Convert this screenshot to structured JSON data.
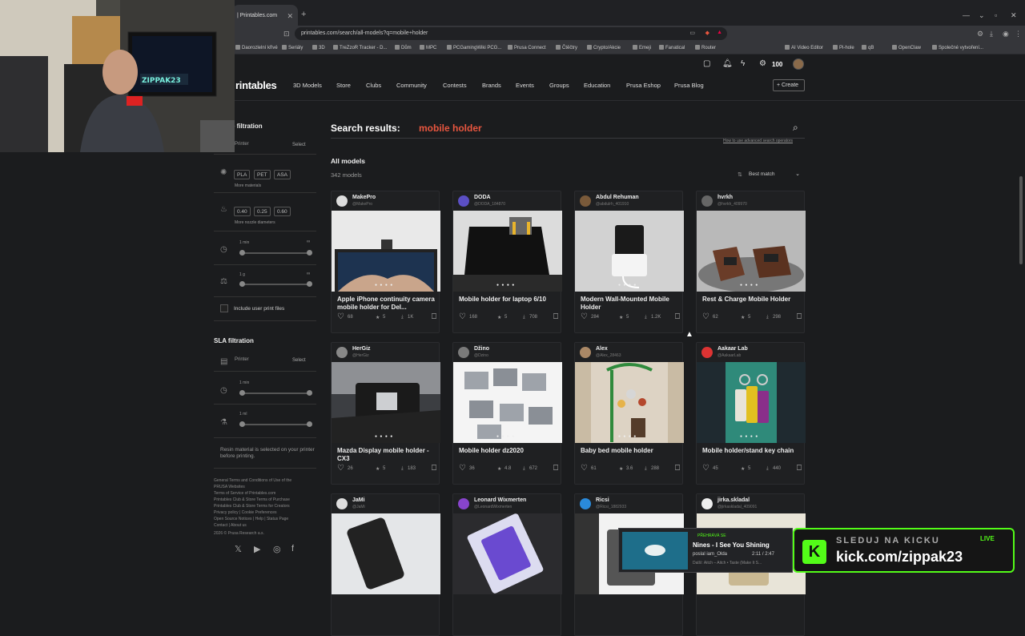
{
  "browser": {
    "tab_title": "| Printables.com",
    "url": "printables.com/search/all-models?q=mobile+holder",
    "bookmarks": [
      "Daorozlelní křivé",
      "Seriály",
      "3D",
      "TreZzoR Tracker - D...",
      "Dům",
      "MPC",
      "PCGamingWiki PCG...",
      "Prusa Connect",
      "Čtěčtry",
      "Crypto/Akcie",
      "Emeji",
      "Fanatical",
      "Router",
      "AI Video Editor",
      "Pi-hole",
      "qB",
      "OpenClaw",
      "Společné vytvoření..."
    ]
  },
  "header": {
    "logo": "rintables",
    "points": "100",
    "nav": [
      "3D Models",
      "Store",
      "Clubs",
      "Community",
      "Contests",
      "Brands",
      "Events",
      "Groups",
      "Education",
      "Prusa Eshop",
      "Prusa Blog"
    ],
    "create": "+ Create"
  },
  "sidebar": {
    "fdm_title": "e filtration",
    "printer_label": "Printer",
    "select_label": "Select",
    "materials": [
      "PLA",
      "PET",
      "ASA"
    ],
    "more_materials": "More materials",
    "nozzles": [
      "0.40",
      "0.25",
      "0.60"
    ],
    "more_nozzles": "More nozzle diameters",
    "time_min": "1 min",
    "time_max": "∞",
    "weight_min": "1 g",
    "weight_max": "∞",
    "user_print": "Include user print files",
    "sla_title": "SLA filtration",
    "sla_printer": "Printer",
    "sla_select": "Select",
    "sla_time_min": "1 min",
    "sla_vol_min": "1 ml",
    "resin_note": "Resin material is selected on your printer before printing.",
    "footer_links": [
      "General Terms and Conditions of Use of the",
      "PRUSA Websites",
      "Terms of Service of Printables.com",
      "Printables Club & Store Terms of Purchase",
      "Printables Club & Store Terms for Creators",
      "Privacy policy  |  Cookie Preferences",
      "Open Source Notices  |  Help  |  Status Page",
      "Contact  |  About us",
      "2026 © Prusa Research a.s."
    ]
  },
  "search": {
    "label": "Search results:",
    "query": "mobile holder",
    "advanced": "How to use advanced search operators",
    "section": "All models",
    "count": "342 models",
    "sort": "Best match"
  },
  "cards": [
    {
      "author": "MakePro",
      "handle": "@MakePro",
      "title": "Apple iPhone continuity camera mobile holder for Del...",
      "likes": "68",
      "stars": "5",
      "downloads": "1K",
      "avatar": "#ddd",
      "img": "laptop-dark"
    },
    {
      "author": "DODA",
      "handle": "@DODA_184870",
      "title": "Mobile holder for laptop 6/10",
      "likes": "168",
      "stars": "5",
      "downloads": "708",
      "avatar": "#5b4fc4",
      "img": "laptop-black"
    },
    {
      "author": "Abdul Rehuman",
      "handle": "@abdulrh_401910",
      "title": "Modern Wall-Mounted Mobile Holder",
      "likes": "284",
      "stars": "5",
      "downloads": "1.2K",
      "avatar": "#7a5a3a",
      "img": "white-wall"
    },
    {
      "author": "hvrkh",
      "handle": "@hvrkh_409970",
      "title": "Rest & Charge Mobile Holder",
      "likes": "62",
      "stars": "5",
      "downloads": "298",
      "avatar": "#666",
      "img": "wood-round"
    },
    {
      "author": "HerGiz",
      "handle": "@HerGiz",
      "title": "Mazda Display mobile holder - CX3",
      "likes": "26",
      "stars": "5",
      "downloads": "183",
      "avatar": "#888",
      "img": "car-dash"
    },
    {
      "author": "Džino",
      "handle": "@Dzino",
      "title": "Mobile holder dz2020",
      "likes": "36",
      "stars": "4.8",
      "downloads": "672",
      "avatar": "#7a7a7a",
      "img": "grey-stands"
    },
    {
      "author": "Alex",
      "handle": "@Alex_28463",
      "title": "Baby bed mobile holder",
      "likes": "61",
      "stars": "3.6",
      "downloads": "288",
      "avatar": "#aa8866",
      "img": "baby-bed"
    },
    {
      "author": "Aakaar Lab",
      "handle": "@AakaarLab",
      "title": "Mobile holder/stand key chain",
      "likes": "45",
      "stars": "5",
      "downloads": "440",
      "avatar": "#d33",
      "img": "keychain"
    },
    {
      "author": "JaMi",
      "handle": "@JaMi",
      "title": "",
      "likes": "",
      "stars": "",
      "downloads": "",
      "avatar": "#ddd",
      "img": "light-phone"
    },
    {
      "author": "Leonard Wixmerten",
      "handle": "@LeonardWixmerten",
      "title": "",
      "likes": "",
      "stars": "",
      "downloads": "",
      "avatar": "#8844cc",
      "img": "purple"
    },
    {
      "author": "Ricsi",
      "handle": "@Ricsi_1882933",
      "title": "",
      "likes": "",
      "stars": "",
      "downloads": "",
      "avatar": "#2a8adb",
      "img": "dark-stand"
    },
    {
      "author": "jirka.skladal",
      "handle": "@jirkaskladal_409091",
      "title": "",
      "likes": "",
      "stars": "",
      "downloads": "",
      "avatar": "#eee",
      "img": "light2"
    }
  ],
  "overlay": {
    "music_label": "PŘEHRÁVÁ SE",
    "music_title": "Nines - I See You Shining",
    "music_by": "poslal iam_Olda",
    "music_time": "2:11 / 2:47",
    "music_next": "Další: Aitch – Aitch • Taste (Make It S...",
    "kick_top": "SLEDUJ NA KICKU",
    "kick_url": "kick.com/zippak23",
    "live": "LIVE",
    "webcam_text": "ZIPPAK23"
  }
}
